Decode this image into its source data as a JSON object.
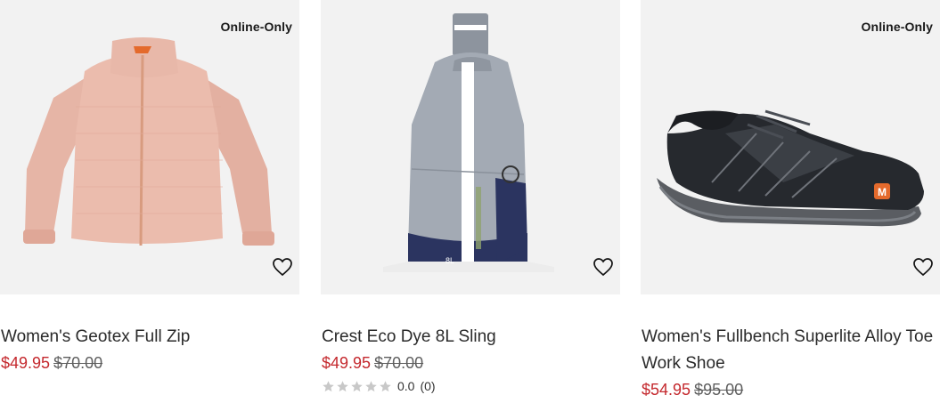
{
  "products": [
    {
      "badge": "Online-Only",
      "name": "Women's Geotex Full Zip",
      "sale_price": "$49.95",
      "original_price": "$70.00",
      "image_icon": "jacket-icon",
      "wishlist_icon": "heart-outline-icon"
    },
    {
      "badge": "",
      "name": "Crest Eco Dye 8L Sling",
      "sale_price": "$49.95",
      "original_price": "$70.00",
      "image_icon": "sling-bag-icon",
      "wishlist_icon": "heart-outline-icon",
      "rating_value": "0.0",
      "rating_count": "(0)",
      "rating_stars": 0
    },
    {
      "badge": "Online-Only",
      "name": "Women's Fullbench Superlite Alloy Toe Work Shoe",
      "sale_price": "$54.95",
      "original_price": "$95.00",
      "image_icon": "shoe-icon",
      "wishlist_icon": "heart-outline-icon"
    }
  ],
  "colors": {
    "sale": "#c4282d",
    "card_bg": "#f2f2f2",
    "star_empty": "#c8c8c8"
  }
}
